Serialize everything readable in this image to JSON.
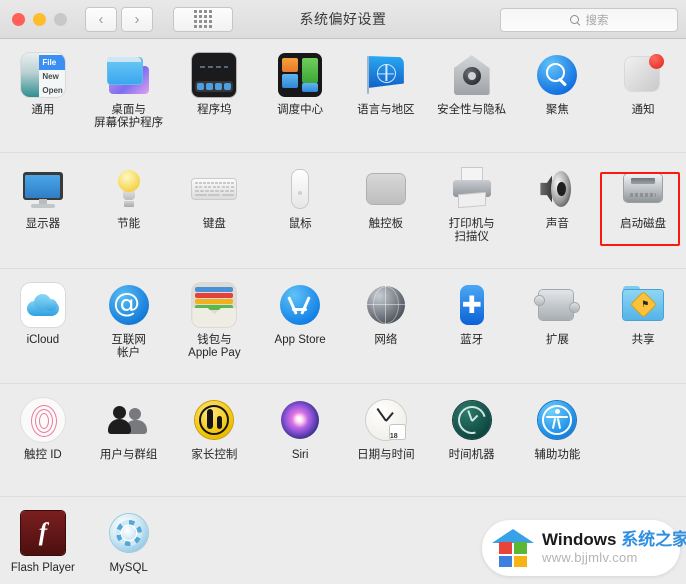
{
  "window": {
    "title": "系统偏好设置",
    "traffic_lights": [
      "close",
      "minimize",
      "zoom"
    ],
    "nav": {
      "back": "‹",
      "forward": "›",
      "show_all": "show-all-grid"
    },
    "search": {
      "placeholder": "搜索",
      "value": "",
      "icon": "search-icon"
    }
  },
  "highlight": {
    "color": "#fc1a10",
    "target": "启动磁盘"
  },
  "rows": [
    {
      "panes": [
        {
          "label": "通用",
          "icon": "general-icon",
          "art": "general",
          "menu": {
            "item1": "File",
            "item2": "New",
            "item3": "Open"
          }
        },
        {
          "label": "桌面与\n屏幕保护程序",
          "icon": "desktop-screensaver-icon",
          "art": "desk"
        },
        {
          "label": "程序坞",
          "icon": "dock-icon",
          "art": "dock"
        },
        {
          "label": "调度中心",
          "icon": "mission-control-icon",
          "art": "mission"
        },
        {
          "label": "语言与地区",
          "icon": "language-region-icon",
          "art": "lang"
        },
        {
          "label": "安全性与隐私",
          "icon": "security-privacy-icon",
          "art": "sec"
        },
        {
          "label": "聚焦",
          "icon": "spotlight-icon",
          "art": "spot"
        },
        {
          "label": "通知",
          "icon": "notifications-icon",
          "art": "notif"
        }
      ]
    },
    {
      "panes": [
        {
          "label": "显示器",
          "icon": "displays-icon",
          "art": "disp"
        },
        {
          "label": "节能",
          "icon": "energy-saver-icon",
          "art": "energy"
        },
        {
          "label": "键盘",
          "icon": "keyboard-icon",
          "art": "kbd"
        },
        {
          "label": "鼠标",
          "icon": "mouse-icon",
          "art": "mouse"
        },
        {
          "label": "触控板",
          "icon": "trackpad-icon",
          "art": "track"
        },
        {
          "label": "打印机与\n扫描仪",
          "icon": "printers-scanners-icon",
          "art": "print"
        },
        {
          "label": "声音",
          "icon": "sound-icon",
          "art": "sound"
        },
        {
          "label": "启动磁盘",
          "icon": "startup-disk-icon",
          "art": "startup"
        }
      ]
    },
    {
      "panes": [
        {
          "label": "iCloud",
          "icon": "icloud-icon",
          "art": "icloud"
        },
        {
          "label": "互联网\n帐户",
          "icon": "internet-accounts-icon",
          "art": "at"
        },
        {
          "label": "钱包与\nApple Pay",
          "icon": "wallet-applepay-icon",
          "art": "wallet"
        },
        {
          "label": "App Store",
          "icon": "app-store-icon",
          "art": "appstore"
        },
        {
          "label": "网络",
          "icon": "network-icon",
          "art": "net"
        },
        {
          "label": "蓝牙",
          "icon": "bluetooth-icon",
          "art": "bt"
        },
        {
          "label": "扩展",
          "icon": "extensions-icon",
          "art": "ext"
        },
        {
          "label": "共享",
          "icon": "sharing-icon",
          "art": "share"
        }
      ]
    },
    {
      "panes": [
        {
          "label": "触控 ID",
          "icon": "touch-id-icon",
          "art": "touchid"
        },
        {
          "label": "用户与群组",
          "icon": "users-groups-icon",
          "art": "users"
        },
        {
          "label": "家长控制",
          "icon": "parental-controls-icon",
          "art": "parent"
        },
        {
          "label": "Siri",
          "icon": "siri-icon",
          "art": "siri"
        },
        {
          "label": "日期与时间",
          "icon": "date-time-icon",
          "art": "date",
          "calendar_day": "18"
        },
        {
          "label": "时间机器",
          "icon": "time-machine-icon",
          "art": "tm"
        },
        {
          "label": "辅助功能",
          "icon": "accessibility-icon",
          "art": "access"
        },
        {
          "label": "",
          "icon": "",
          "art": "empty"
        }
      ]
    },
    {
      "panes": [
        {
          "label": "Flash Player",
          "icon": "flash-player-icon",
          "art": "flash"
        },
        {
          "label": "MySQL",
          "icon": "mysql-icon",
          "art": "mysql"
        },
        {
          "label": "",
          "icon": "",
          "art": "empty"
        },
        {
          "label": "",
          "icon": "",
          "art": "empty"
        },
        {
          "label": "",
          "icon": "",
          "art": "empty"
        },
        {
          "label": "",
          "icon": "",
          "art": "empty"
        },
        {
          "label": "",
          "icon": "",
          "art": "empty"
        },
        {
          "label": "",
          "icon": "",
          "art": "empty"
        }
      ]
    }
  ],
  "watermark": {
    "brand_en": "Windows ",
    "brand_cn": "系统之家",
    "url": "www.bjjmlv.com",
    "logo": "windows-house-logo"
  }
}
